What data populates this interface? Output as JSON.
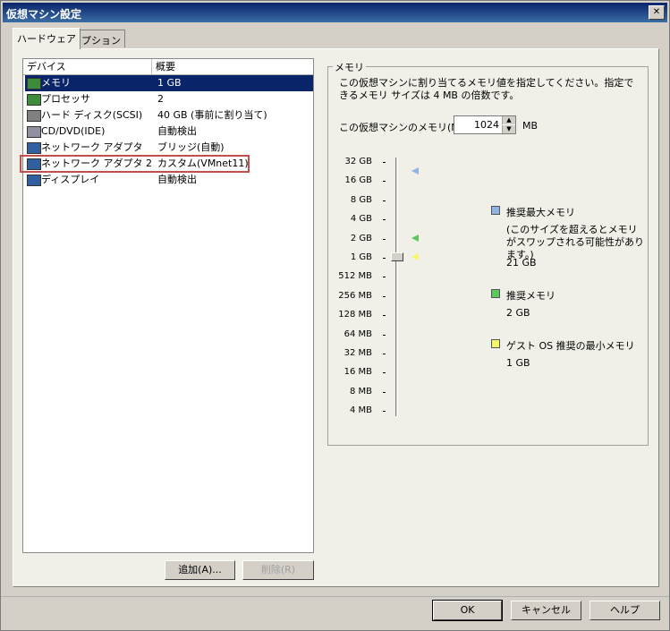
{
  "window": {
    "title": "仮想マシン設定",
    "close_label": "✕"
  },
  "tabs": {
    "hardware": "ハードウェア",
    "options": "オプション"
  },
  "device_list": {
    "col_device": "デバイス",
    "col_summary": "概要",
    "rows": [
      {
        "device": "メモリ",
        "summary": "1 GB",
        "icon": "memory-icon",
        "color": "#3c8c3c"
      },
      {
        "device": "プロセッサ",
        "summary": "2",
        "icon": "processor-icon",
        "color": "#3c8c3c"
      },
      {
        "device": "ハード ディスク(SCSI)",
        "summary": "40 GB (事前に割り当て)",
        "icon": "hard-disk-icon",
        "color": "#808080"
      },
      {
        "device": "CD/DVD(IDE)",
        "summary": "自動検出",
        "icon": "cd-dvd-icon",
        "color": "#9090a0"
      },
      {
        "device": "ネットワーク アダプタ",
        "summary": "ブリッジ(自動)",
        "icon": "network-adapter-icon",
        "color": "#3060a0"
      },
      {
        "device": "ネットワーク アダプタ 2",
        "summary": "カスタム(VMnet11)",
        "icon": "network-adapter-icon",
        "color": "#3060a0"
      },
      {
        "device": "ディスプレイ",
        "summary": "自動検出",
        "icon": "display-icon",
        "color": "#3060a0"
      }
    ]
  },
  "buttons": {
    "add": "追加(A)...",
    "remove": "削除(R)",
    "ok": "OK",
    "cancel": "キャンセル",
    "help": "ヘルプ"
  },
  "memory": {
    "group_label": "メモリ",
    "description": "この仮想マシンに割り当てるメモリ値を指定してください。指定できるメモリ サイズは 4 MB の倍数です。",
    "field_label": "この仮想マシンのメモリ(M):",
    "value": "1024",
    "unit": "MB",
    "scale_ticks": [
      "32 GB",
      "16 GB",
      "8 GB",
      "4 GB",
      "2 GB",
      "1 GB",
      "512 MB",
      "256 MB",
      "128 MB",
      "64 MB",
      "32 MB",
      "16 MB",
      "8 MB",
      "4 MB"
    ],
    "legend": {
      "max": {
        "title": "推奨最大メモリ",
        "note": "(このサイズを超えるとメモリがスワップされる可能性があります。)",
        "value": "21 GB",
        "color": "#8fb4e3"
      },
      "recommended": {
        "title": "推奨メモリ",
        "value": "2 GB",
        "color": "#5cc85c"
      },
      "min": {
        "title": "ゲスト OS 推奨の最小メモリ",
        "value": "1 GB",
        "color": "#f6f66a"
      }
    }
  }
}
